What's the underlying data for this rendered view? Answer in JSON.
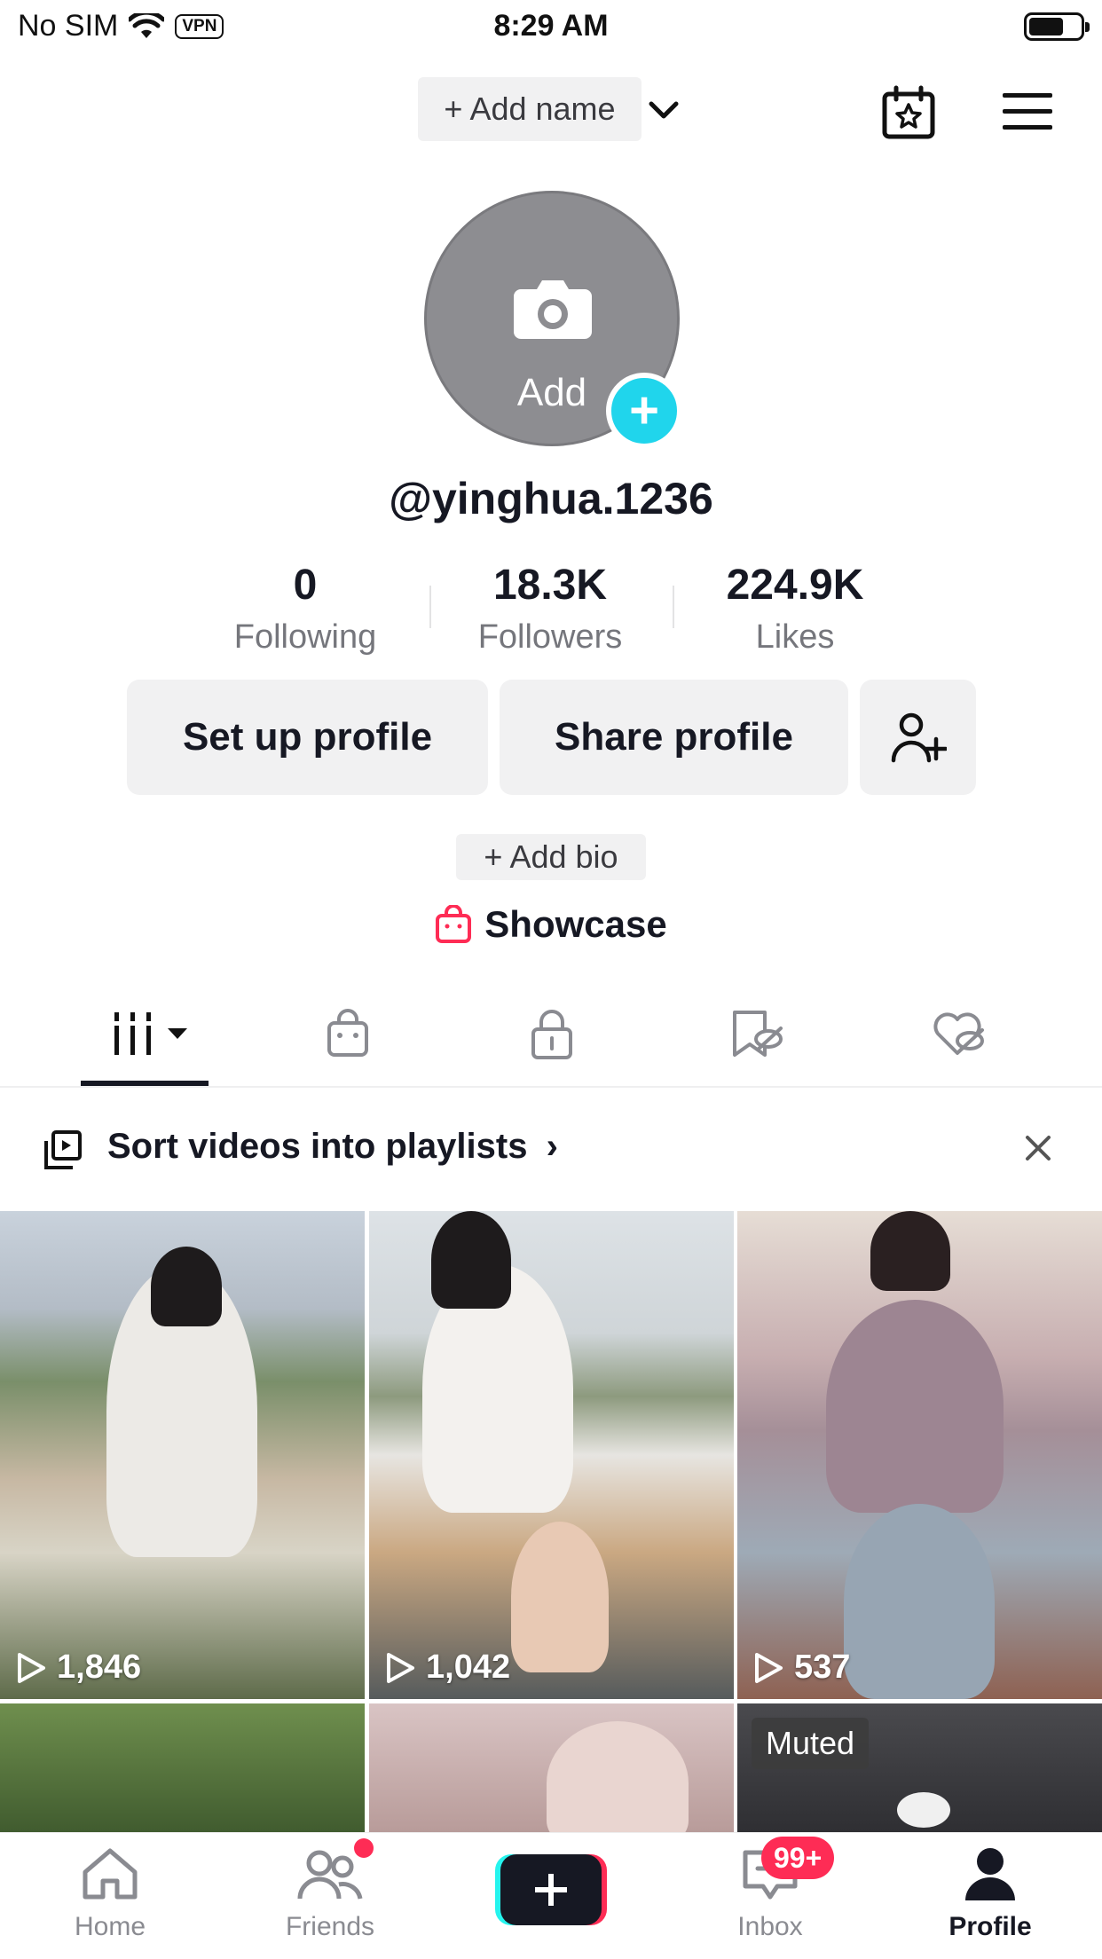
{
  "status_bar": {
    "carrier": "No SIM",
    "vpn": "VPN",
    "time": "8:29 AM"
  },
  "header": {
    "add_name": "+ Add name"
  },
  "avatar": {
    "add_label": "Add",
    "plus": "+"
  },
  "profile": {
    "username": "@yinghua.1236"
  },
  "stats": [
    {
      "value": "0",
      "label": "Following"
    },
    {
      "value": "18.3K",
      "label": "Followers"
    },
    {
      "value": "224.9K",
      "label": "Likes"
    }
  ],
  "buttons": {
    "setup": "Set up profile",
    "share": "Share profile"
  },
  "bio": {
    "add_bio": "+ Add bio"
  },
  "showcase": {
    "label": "Showcase"
  },
  "banner": {
    "text": "Sort videos into playlists",
    "chevron": "›"
  },
  "videos": [
    {
      "views": "1,846"
    },
    {
      "views": "1,042"
    },
    {
      "views": "537"
    },
    {
      "views": ""
    },
    {
      "views": ""
    },
    {
      "label": "Muted"
    }
  ],
  "nav": {
    "home": "Home",
    "friends": "Friends",
    "inbox": "Inbox",
    "inbox_badge": "99+",
    "profile": "Profile"
  },
  "colors": {
    "accent_cyan": "#20d5ec",
    "accent_red": "#fe2c55",
    "text": "#161823",
    "muted": "#75767c"
  }
}
